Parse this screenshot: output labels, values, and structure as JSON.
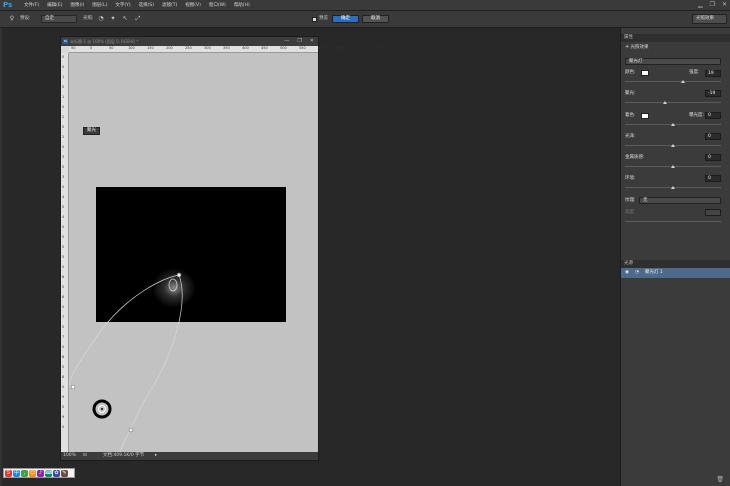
{
  "app": {
    "logo": "Ps"
  },
  "menu": [
    "文件(F)",
    "编辑(E)",
    "图像(I)",
    "图层(L)",
    "文字(Y)",
    "选择(S)",
    "滤镜(T)",
    "视图(V)",
    "窗口(W)",
    "帮助(H)"
  ],
  "window_controls": [
    "▁",
    "❐",
    "✕"
  ],
  "options": {
    "preset_label": "预设:",
    "preset_value": "自定",
    "light_label": "光照:",
    "preview_label": "预览",
    "ok_label": "确定",
    "cancel_label": "取消",
    "workspace": "光照效果"
  },
  "document": {
    "title": "未标题-1 @ 100% (图层 0, RGB/8) *",
    "controls": [
      "—",
      "❐",
      "✕"
    ],
    "ruler_top": [
      "50",
      "0",
      "50",
      "100",
      "150",
      "200",
      "250",
      "300",
      "350",
      "400",
      "450",
      "500",
      "550",
      "600",
      "650",
      "700",
      "750"
    ],
    "ruler_left": [
      "0",
      "5",
      "1",
      "0",
      "1",
      "5",
      "2",
      "0",
      "2",
      "5",
      "3",
      "0",
      "3",
      "5",
      "4",
      "0",
      "4",
      "5",
      "5",
      "0",
      "5",
      "5",
      "6",
      "0",
      "6",
      "5",
      "7",
      "0",
      "7",
      "5",
      "8",
      "0",
      "8",
      "5",
      "9",
      "0",
      "9",
      "5"
    ],
    "tooltip": "聚光",
    "zoom": "100%",
    "status": "文档:409.1K/0 字节"
  },
  "properties": {
    "header": "属性",
    "title": "光照效果",
    "light_type": "聚光灯",
    "color_label": "颜色:",
    "intensity_label": "强度:",
    "intensity_value": "19",
    "hotspot_label": "聚光:",
    "hotspot_value": "-19",
    "coloring_label": "着色:",
    "exposure_label": "曝光度:",
    "exposure_value": "0",
    "gloss_label": "光泽:",
    "gloss_value": "0",
    "metallic_label": "金属质感:",
    "metallic_value": "0",
    "ambience_label": "环境:",
    "ambience_value": "0",
    "texture_label": "纹理:",
    "texture_value": "无",
    "height_label": "高度:"
  },
  "lights_panel": {
    "header": "光源",
    "layer_name": "聚光灯 1"
  },
  "colors": {
    "accent": "#2d6fbf",
    "canvas": "#c2c2c2",
    "panel": "#3b3b3b"
  }
}
